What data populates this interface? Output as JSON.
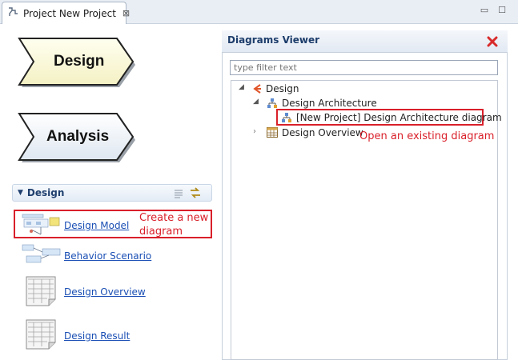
{
  "tab": {
    "title": "Project New Project",
    "close": "⊠"
  },
  "window": {
    "minimize": "▭",
    "maximize": "☐"
  },
  "chevrons": [
    {
      "label": "Design",
      "fill": "#fbfbe0"
    },
    {
      "label": "Analysis",
      "fill": "#f1f5fb"
    }
  ],
  "design_section": {
    "title": "Design",
    "items": [
      {
        "label": "Design Model"
      },
      {
        "label": "Behavior Scenario"
      },
      {
        "label": "Design Overview"
      },
      {
        "label": "Design Result"
      }
    ]
  },
  "annotations": {
    "create_new": "Create a new\ndiagram",
    "open_existing": "Open an existing diagram"
  },
  "diagrams_viewer": {
    "title": "Diagrams Viewer",
    "filter_placeholder": "type filter text",
    "tree": {
      "root": "Design",
      "arch": "Design Architecture",
      "arch_diagram": "[New Project] Design Architecture diagram",
      "overview": "Design Overview"
    }
  },
  "colors": {
    "highlight_red": "#d9202a",
    "link_blue": "#1a4fb4",
    "close_red": "#d82a2a"
  }
}
